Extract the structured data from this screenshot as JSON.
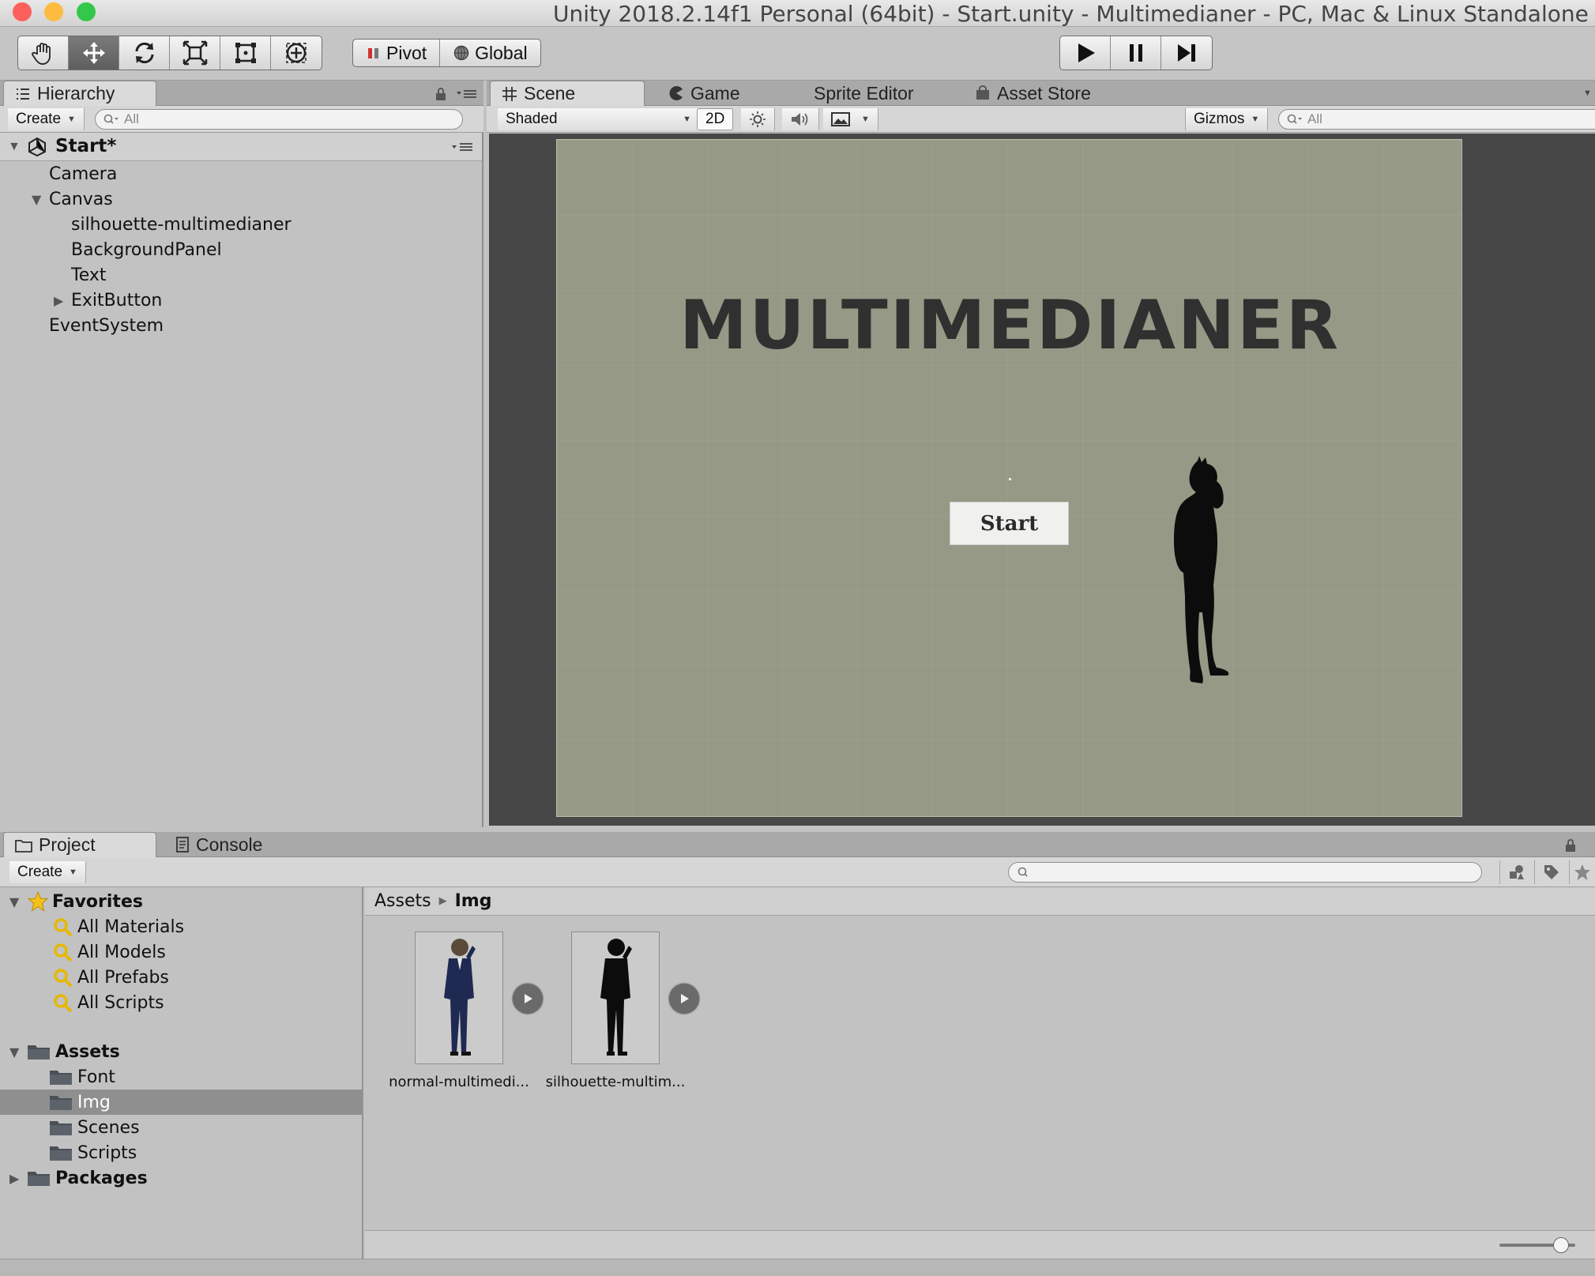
{
  "window": {
    "title": "Unity 2018.2.14f1 Personal (64bit) - Start.unity - Multimedianer - PC, Mac & Linux Standalone (Personal) <Metal>",
    "traffic_lights": {
      "close": "#fc605c",
      "minimize": "#fdbc40",
      "zoom": "#34c84a"
    }
  },
  "toolbar": {
    "transform_tools": [
      {
        "icon": "hand-icon",
        "active": false
      },
      {
        "icon": "move-icon",
        "active": true
      },
      {
        "icon": "rotate-icon",
        "active": false
      },
      {
        "icon": "scale-icon",
        "active": false
      },
      {
        "icon": "rect-tool-icon",
        "active": false
      },
      {
        "icon": "transform-tool-icon",
        "active": false
      }
    ],
    "pivot_label": "Pivot",
    "global_label": "Global",
    "play_controls": [
      "play-icon",
      "pause-icon",
      "step-icon"
    ]
  },
  "hierarchy": {
    "tab_label": "Hierarchy",
    "create_label": "Create",
    "search_placeholder": "All",
    "scene_name": "Start*",
    "items": [
      {
        "label": "Camera",
        "depth": 1,
        "expander": "none"
      },
      {
        "label": "Canvas",
        "depth": 1,
        "expander": "expanded"
      },
      {
        "label": "silhouette-multimedianer",
        "depth": 2,
        "expander": "none"
      },
      {
        "label": "BackgroundPanel",
        "depth": 2,
        "expander": "none"
      },
      {
        "label": "Text",
        "depth": 2,
        "expander": "none"
      },
      {
        "label": "ExitButton",
        "depth": 2,
        "expander": "collapsed"
      },
      {
        "label": "EventSystem",
        "depth": 1,
        "expander": "none"
      }
    ]
  },
  "scene_tabs": {
    "scene": "Scene",
    "game": "Game",
    "sprite_editor": "Sprite Editor",
    "asset_store": "Asset Store"
  },
  "scene_toolbar": {
    "shading_mode": "Shaded",
    "mode_2d": "2D",
    "gizmos_label": "Gizmos",
    "search_placeholder": "All"
  },
  "scene_view": {
    "canvas_color": "#969985",
    "backdrop_color": "#474747",
    "heading": "MULTIMEDIANER",
    "button_label": "Start"
  },
  "project": {
    "tab_project": "Project",
    "tab_console": "Console",
    "create_label": "Create",
    "favorites": {
      "label": "Favorites",
      "items": [
        "All Materials",
        "All Models",
        "All Prefabs",
        "All Scripts"
      ]
    },
    "assets": {
      "label": "Assets",
      "folders": [
        "Font",
        "Img",
        "Scenes",
        "Scripts"
      ],
      "selected": "Img"
    },
    "packages_label": "Packages",
    "breadcrumb": {
      "root": "Assets",
      "current": "Img"
    },
    "files": [
      {
        "label": "normal-multimedi...",
        "thumbnail": "suited-figure",
        "icon": "play-icon"
      },
      {
        "label": "silhouette-multim...",
        "thumbnail": "black-silhouette",
        "icon": "play-icon"
      }
    ],
    "zoom_slider": 0.9
  }
}
